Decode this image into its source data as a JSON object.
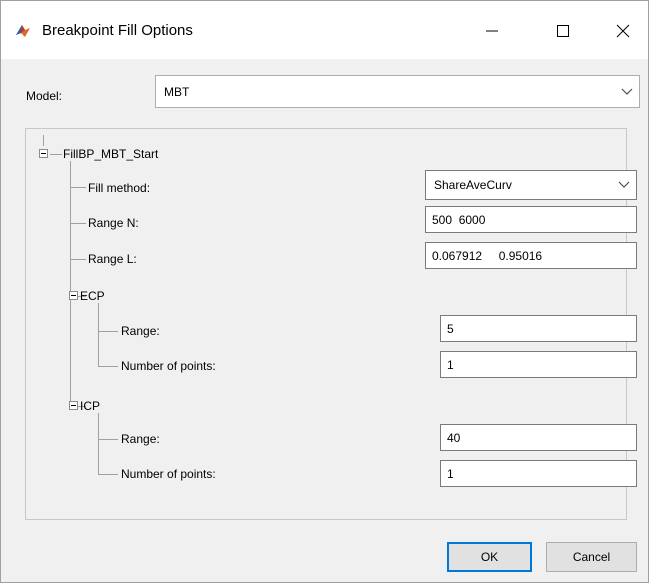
{
  "window": {
    "title": "Breakpoint Fill Options",
    "app_icon": "matlab-icon",
    "controls": [
      "minimize-icon",
      "maximize-icon",
      "close-icon"
    ]
  },
  "model": {
    "label": "Model:",
    "value": "MBT"
  },
  "tree": {
    "root": {
      "label": "FillBP_MBT_Start",
      "fill_method": {
        "label": "Fill method:",
        "value": "ShareAveCurv"
      },
      "range_n": {
        "label": "Range N:",
        "value": "500  6000"
      },
      "range_l": {
        "label": "Range L:",
        "value": "0.067912     0.95016"
      },
      "ecp": {
        "label": "ECP",
        "range": {
          "label": "Range:",
          "value": "5"
        },
        "points": {
          "label": "Number of points:",
          "value": "1"
        }
      },
      "icp": {
        "label": "ICP",
        "range": {
          "label": "Range:",
          "value": "40"
        },
        "points": {
          "label": "Number of points:",
          "value": "1"
        }
      }
    }
  },
  "buttons": {
    "ok": "OK",
    "cancel": "Cancel"
  },
  "colors": {
    "default_button_border": "#0078d7",
    "window_bg": "#f0f0f0"
  }
}
